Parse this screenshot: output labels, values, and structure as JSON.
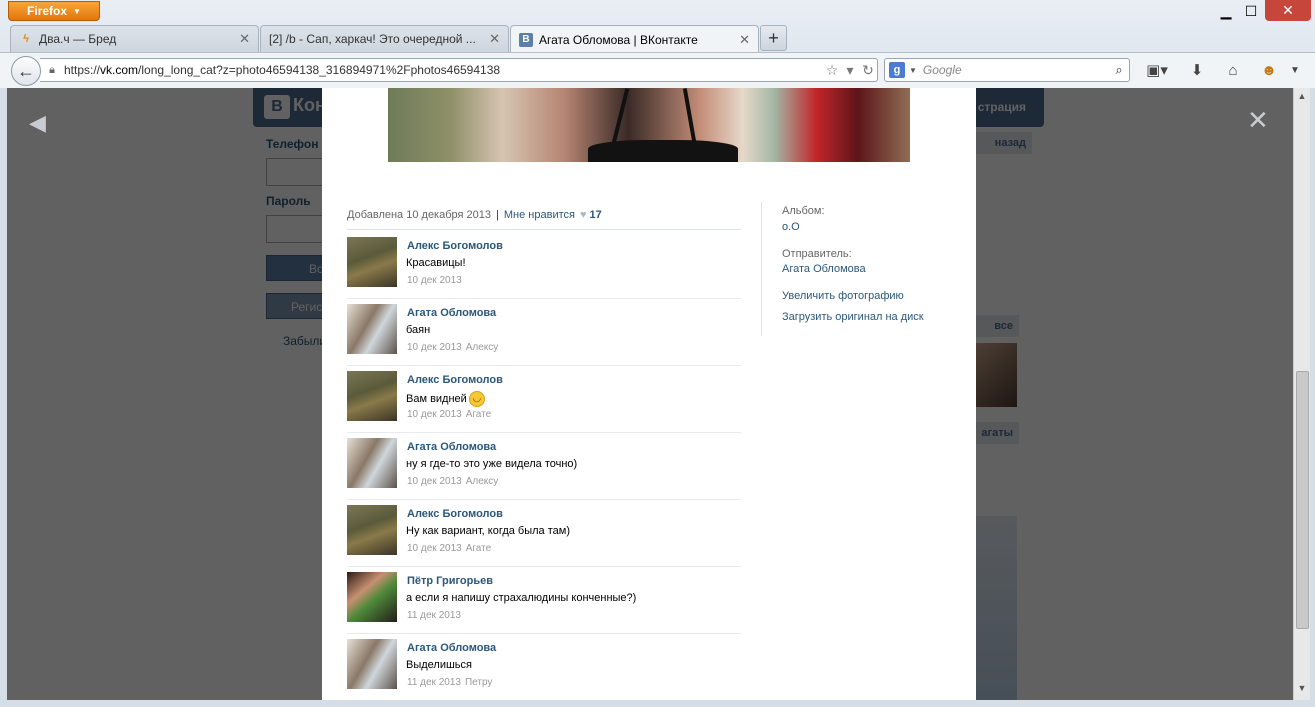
{
  "browser": {
    "menu_label": "Firefox",
    "tabs": [
      {
        "title": "Два.ч — Бред"
      },
      {
        "title": "[2] /b - Сап, харкач! Это очередной ..."
      },
      {
        "title": "Агата Обломова | ВКонтакте",
        "active": true
      }
    ],
    "url": {
      "prefix": "https://",
      "domain": "vk.com",
      "path": "/long_long_cat?z=photo46594138_316894971%2Fphotos46594138"
    },
    "search_placeholder": "Google",
    "search_engine_letter": "g",
    "window_controls": {
      "minimize": "▁",
      "maximize": "☐",
      "close": "✕"
    }
  },
  "background_site": {
    "logo_letter": "В",
    "logo_text": "Конт",
    "header_right": "страция",
    "phone_label": "Телефон",
    "password_label": "Пароль",
    "login_button": "Во",
    "register_button": "Регис",
    "forgot_link": "Забыли",
    "back_label": "назад",
    "all_label": "все",
    "pages_label": "агаты"
  },
  "viewer": {
    "added_label": "Добавлена 10 декабря 2013",
    "separator": "|",
    "like_label": "Мне нравится",
    "like_count": "17",
    "album_label": "Альбом:",
    "album_name": "о.О",
    "sender_label": "Отправитель:",
    "sender_name": "Агата Обломова",
    "enlarge_link": "Увеличить фотографию",
    "download_link": "Загрузить оригинал на диск",
    "close_symbol": "✕",
    "prev_symbol": "◀"
  },
  "comments": [
    {
      "author": "Алекс Богомолов",
      "text": "Красавицы!",
      "date": "10 дек 2013",
      "reply_to": "",
      "avatar": "alex"
    },
    {
      "author": "Агата Обломова",
      "text": "баян",
      "date": "10 дек 2013",
      "reply_to": "Алексу",
      "avatar": "agata"
    },
    {
      "author": "Алекс Богомолов",
      "text": "Вам видней",
      "date": "10 дек 2013",
      "reply_to": "Агате",
      "avatar": "alex",
      "emoji": "smile-emoji"
    },
    {
      "author": "Агата Обломова",
      "text": "ну я где-то это уже видела точно)",
      "date": "10 дек 2013",
      "reply_to": "Алексу",
      "avatar": "agata"
    },
    {
      "author": "Алекс Богомолов",
      "text": "Ну как вариант, когда была там)",
      "date": "10 дек 2013",
      "reply_to": "Агате",
      "avatar": "alex"
    },
    {
      "author": "Пётр Григорьев",
      "text": "а если я напишу страхалюдины конченные?)",
      "date": "11 дек 2013",
      "reply_to": "",
      "avatar": "petr"
    },
    {
      "author": "Агата Обломова",
      "text": "Выделишься",
      "date": "11 дек 2013",
      "reply_to": "Петру",
      "avatar": "agata"
    }
  ]
}
